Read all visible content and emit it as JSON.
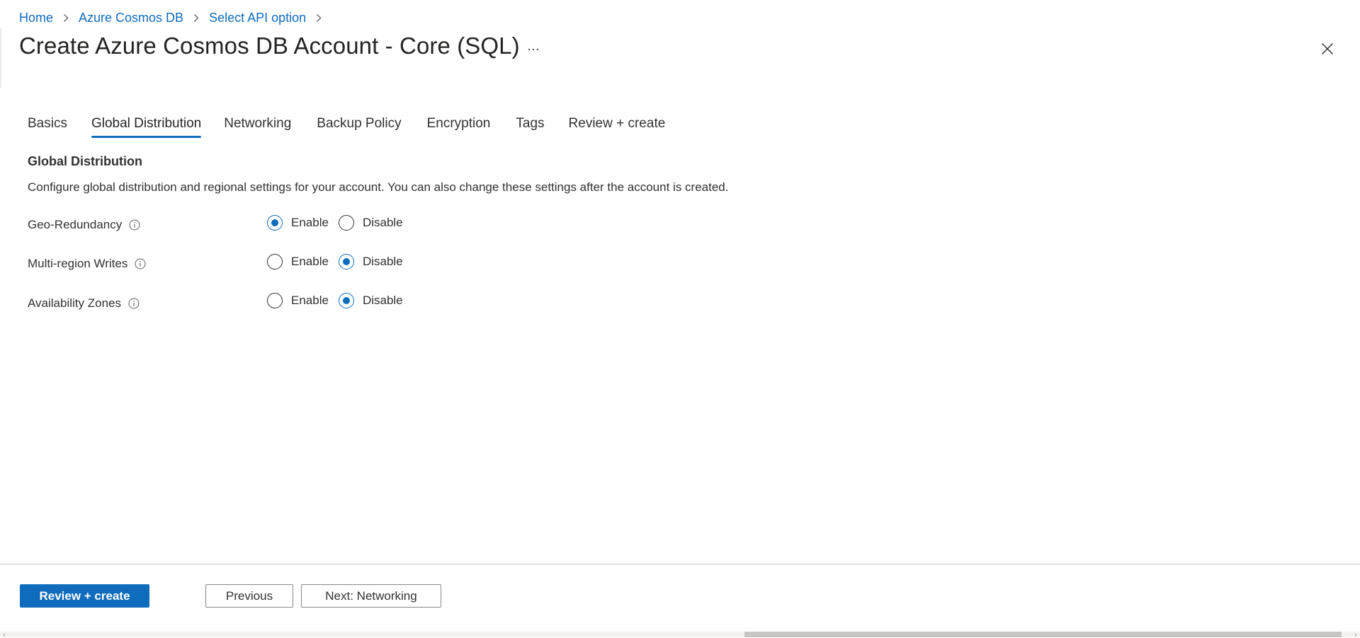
{
  "breadcrumb": [
    "Home",
    "Azure Cosmos DB",
    "Select API option"
  ],
  "page": {
    "title": "Create Azure Cosmos DB Account - Core (SQL)",
    "more_label": "···"
  },
  "tabs": [
    {
      "label": "Basics",
      "active": false
    },
    {
      "label": "Global Distribution",
      "active": true
    },
    {
      "label": "Networking",
      "active": false
    },
    {
      "label": "Backup Policy",
      "active": false
    },
    {
      "label": "Encryption",
      "active": false
    },
    {
      "label": "Tags",
      "active": false
    },
    {
      "label": "Review + create",
      "active": false
    }
  ],
  "section": {
    "title": "Global Distribution",
    "description": "Configure global distribution and regional settings for your account. You can also change these settings after the account is created."
  },
  "fields": [
    {
      "label": "Geo-Redundancy",
      "options": [
        "Enable",
        "Disable"
      ],
      "selected": "Enable"
    },
    {
      "label": "Multi-region Writes",
      "options": [
        "Enable",
        "Disable"
      ],
      "selected": "Disable"
    },
    {
      "label": "Availability Zones",
      "options": [
        "Enable",
        "Disable"
      ],
      "selected": "Disable"
    }
  ],
  "footer": {
    "review_create_label": "Review + create",
    "previous_label": "Previous",
    "next_label": "Next: Networking"
  },
  "colors": {
    "accent": "#0f6cbd",
    "text": "#323130",
    "border": "#8a8886"
  },
  "icons": {
    "breadcrumb_separator": "chevron-right-icon",
    "close": "close-icon",
    "more": "more-options-icon",
    "info": "info-icon"
  }
}
